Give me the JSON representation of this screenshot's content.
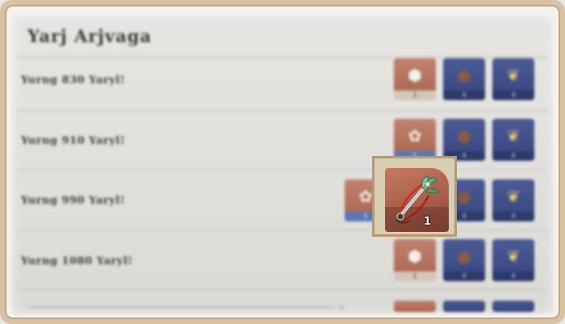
{
  "panel": {
    "title": "Yarj Arjvaga"
  },
  "rows": [
    {
      "label": "Yurng 830 Yaryl!",
      "rewards": [
        {
          "kind": "gem",
          "icon": "crystal-ore-icon",
          "count": "1"
        },
        {
          "kind": "ore",
          "icon": "leather-pouch-icon",
          "count": "4"
        },
        {
          "kind": "wheat",
          "icon": "wheat-icon",
          "count": "4"
        }
      ]
    },
    {
      "label": "Yurng 910 Yaryl!",
      "rewards": [
        {
          "kind": "gem",
          "icon": "crystal-flower-icon",
          "count": "1"
        },
        {
          "kind": "ore",
          "icon": "leather-pouch-icon",
          "count": "4"
        },
        {
          "kind": "wheat",
          "icon": "wheat-icon",
          "count": "4"
        }
      ]
    },
    {
      "label": "Yurng 990 Yaryl!",
      "rewards": [
        {
          "kind": "gem",
          "icon": "crystal-flower-icon",
          "count": "1"
        },
        {
          "kind": "ore",
          "icon": "leather-pouch-icon",
          "count": "4"
        },
        {
          "kind": "wheat",
          "icon": "wheat-icon",
          "count": "4"
        }
      ]
    },
    {
      "label": "Yurng 1080 Yaryl!",
      "rewards": [
        {
          "kind": "gem",
          "icon": "crystal-ore-icon",
          "count": "1"
        },
        {
          "kind": "ore",
          "icon": "leather-pouch-icon",
          "count": "4"
        },
        {
          "kind": "wheat",
          "icon": "wheat-icon",
          "count": "4"
        }
      ]
    }
  ],
  "focused_item": {
    "icon": "bow-staff-weapon-icon",
    "count": "1"
  },
  "colors": {
    "frame": "#d9c2a4",
    "frame_border": "#c4a57e",
    "highlight_border": "#b79a68",
    "gem_bg": "#a8644c",
    "blue_bg": "#36447e"
  }
}
